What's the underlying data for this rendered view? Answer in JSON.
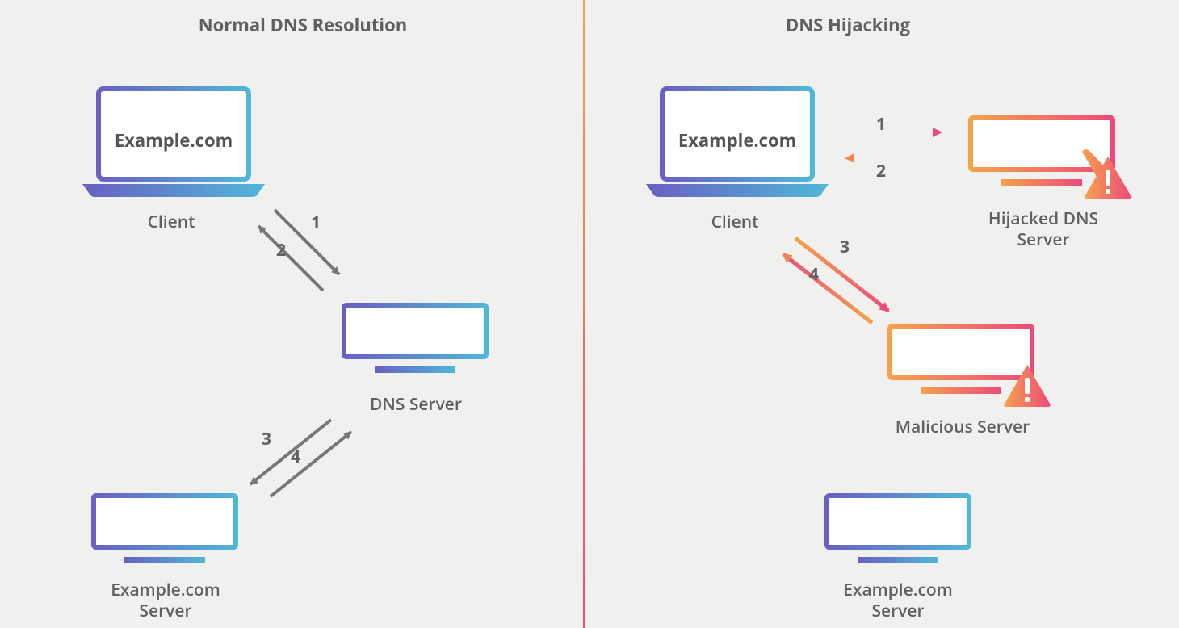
{
  "left": {
    "title": "Normal DNS Resolution",
    "client_label": "Client",
    "client_url": "Example.com",
    "dns_server_label": "DNS Server",
    "origin_server_label": "Example.com Server",
    "steps": {
      "s1": "1",
      "s2": "2",
      "s3": "3",
      "s4": "4"
    }
  },
  "right": {
    "title": "DNS Hijacking",
    "client_label": "Client",
    "client_url": "Example.com",
    "hijacked_label": "Hijacked DNS Server",
    "malicious_label": "Malicious Server",
    "origin_server_label": "Example.com Server",
    "steps": {
      "s1": "1",
      "s2": "2",
      "s3": "3",
      "s4": "4"
    }
  }
}
